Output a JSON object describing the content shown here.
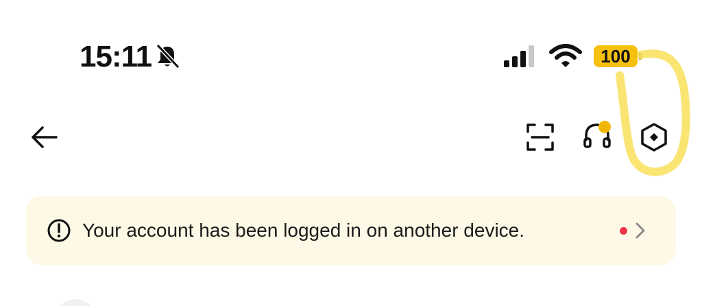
{
  "status_bar": {
    "time": "15:11",
    "battery_level": "100",
    "icons": {
      "bell": "bell-muted-icon",
      "signal": "cellular-signal-icon",
      "wifi": "wifi-icon"
    },
    "battery_color": "#f6c00e"
  },
  "header": {
    "back_icon": "arrow-left-icon",
    "actions": [
      {
        "name": "scan",
        "icon": "scan-icon"
      },
      {
        "name": "support",
        "icon": "headset-icon",
        "has_badge": true
      },
      {
        "name": "settings",
        "icon": "hexagon-settings-icon"
      }
    ],
    "badge_color": "#f2b705"
  },
  "alert": {
    "message": "Your account has been logged in on another device.",
    "icon": "exclamation-circle-icon",
    "unread_dot_color": "#f0334a",
    "background": "#fdf9e6"
  },
  "annotation": {
    "highlight_color": "#f8dc4a"
  }
}
